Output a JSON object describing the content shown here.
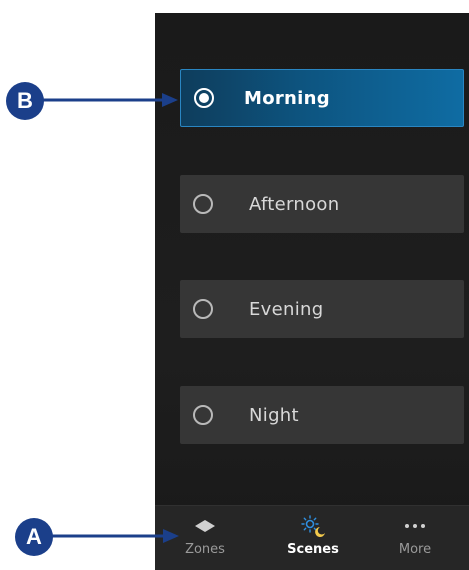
{
  "scenes": [
    {
      "label": "Morning",
      "selected": true
    },
    {
      "label": "Afternoon",
      "selected": false
    },
    {
      "label": "Evening",
      "selected": false
    },
    {
      "label": "Night",
      "selected": false
    }
  ],
  "tabbar": {
    "tabs": [
      {
        "label": "Zones",
        "icon": "zones-diamond-icon",
        "active": false
      },
      {
        "label": "Scenes",
        "icon": "scenes-sun-moon-icon",
        "active": true
      },
      {
        "label": "More",
        "icon": "more-dots-icon",
        "active": false
      }
    ]
  },
  "callouts": {
    "a": "A",
    "b": "B"
  },
  "colors": {
    "accent": "#0f6ca3",
    "callout": "#1b3f8a",
    "scene_icon_sun": "#2f8fe0",
    "scene_icon_moon": "#f2c94c"
  }
}
